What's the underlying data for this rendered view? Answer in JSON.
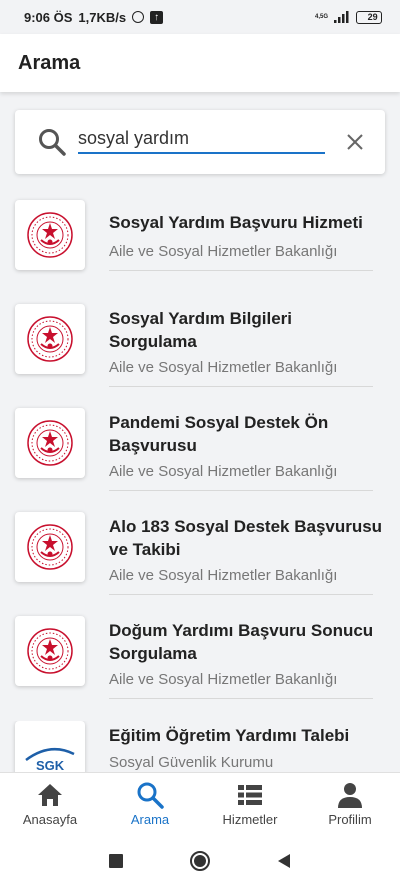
{
  "status_bar": {
    "time": "9:06 ÖS",
    "speed": "1,7KB/s",
    "network_type": "4,5G",
    "battery": "29"
  },
  "header": {
    "title": "Arama"
  },
  "search": {
    "value": "sosyal yardım",
    "placeholder": ""
  },
  "results": [
    {
      "title": "Sosyal Yardım Başvuru Hizmeti",
      "subtitle": "Aile ve Sosyal Hizmetler Bakanlığı",
      "logo": "aile-bakanligi-logo"
    },
    {
      "title": "Sosyal Yardım Bilgileri Sorgulama",
      "subtitle": "Aile ve Sosyal Hizmetler Bakanlığı",
      "logo": "aile-bakanligi-logo"
    },
    {
      "title": "Pandemi Sosyal Destek Ön Başvurusu",
      "subtitle": "Aile ve Sosyal Hizmetler Bakanlığı",
      "logo": "aile-bakanligi-logo"
    },
    {
      "title": "Alo 183 Sosyal Destek Başvurusu ve Takibi",
      "subtitle": "Aile ve Sosyal Hizmetler Bakanlığı",
      "logo": "aile-bakanligi-logo"
    },
    {
      "title": "Doğum Yardımı Başvuru Sonucu Sorgulama",
      "subtitle": "Aile ve Sosyal Hizmetler Bakanlığı",
      "logo": "aile-bakanligi-logo"
    },
    {
      "title": "Eğitim Öğretim Yardımı Talebi",
      "subtitle": "Sosyal Güvenlik Kurumu",
      "logo": "sgk-logo",
      "logo_text": "SGK"
    }
  ],
  "bottom_nav": [
    {
      "label": "Anasayfa",
      "icon": "home-icon",
      "active": false
    },
    {
      "label": "Arama",
      "icon": "search-icon",
      "active": true
    },
    {
      "label": "Hizmetler",
      "icon": "list-icon",
      "active": false
    },
    {
      "label": "Profilim",
      "icon": "person-icon",
      "active": false
    }
  ],
  "colors": {
    "accent": "#1a73c8",
    "ministry_red": "#c8102e",
    "sgk_blue": "#1e5fa8"
  }
}
